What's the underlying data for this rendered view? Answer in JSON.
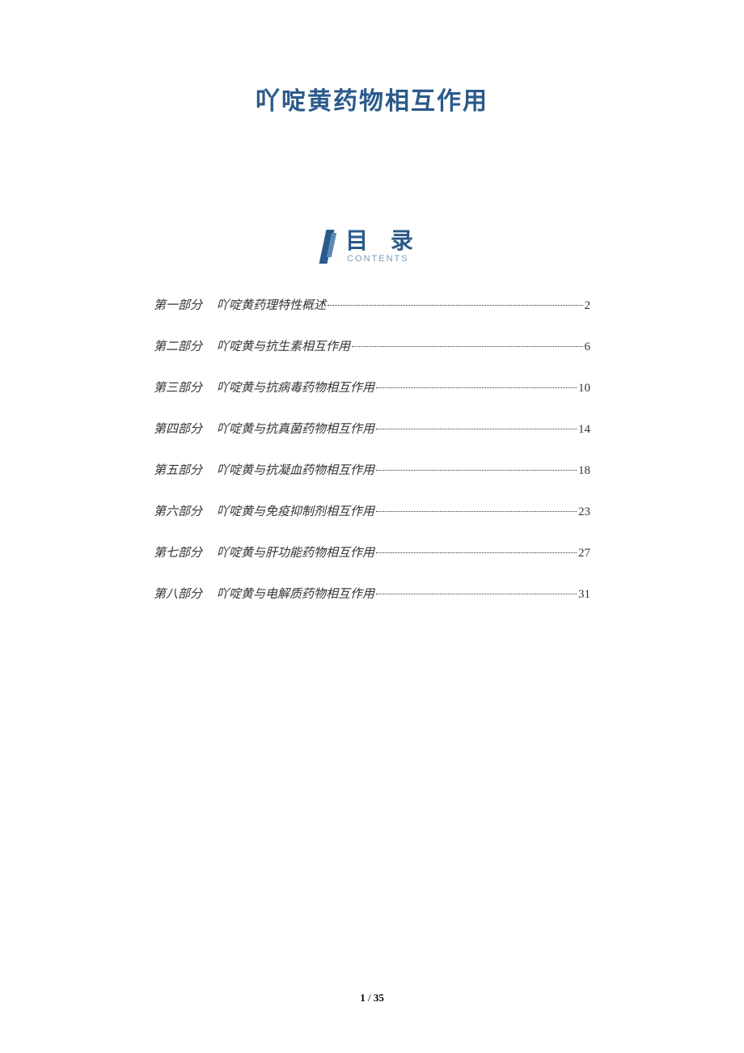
{
  "document": {
    "title": "吖啶黄药物相互作用"
  },
  "toc": {
    "heading": "目 录",
    "subtitle": "CONTENTS",
    "items": [
      {
        "part": "第一部分",
        "chapter": "吖啶黄药理特性概述",
        "page": "2"
      },
      {
        "part": "第二部分",
        "chapter": "吖啶黄与抗生素相互作用",
        "page": "6"
      },
      {
        "part": "第三部分",
        "chapter": "吖啶黄与抗病毒药物相互作用",
        "page": "10"
      },
      {
        "part": "第四部分",
        "chapter": "吖啶黄与抗真菌药物相互作用",
        "page": "14"
      },
      {
        "part": "第五部分",
        "chapter": "吖啶黄与抗凝血药物相互作用",
        "page": "18"
      },
      {
        "part": "第六部分",
        "chapter": "吖啶黄与免疫抑制剂相互作用",
        "page": "23"
      },
      {
        "part": "第七部分",
        "chapter": "吖啶黄与肝功能药物相互作用",
        "page": "27"
      },
      {
        "part": "第八部分",
        "chapter": "吖啶黄与电解质药物相互作用",
        "page": "31"
      }
    ]
  },
  "footer": {
    "current_page": "1",
    "separator": " / ",
    "total_pages": "35"
  }
}
